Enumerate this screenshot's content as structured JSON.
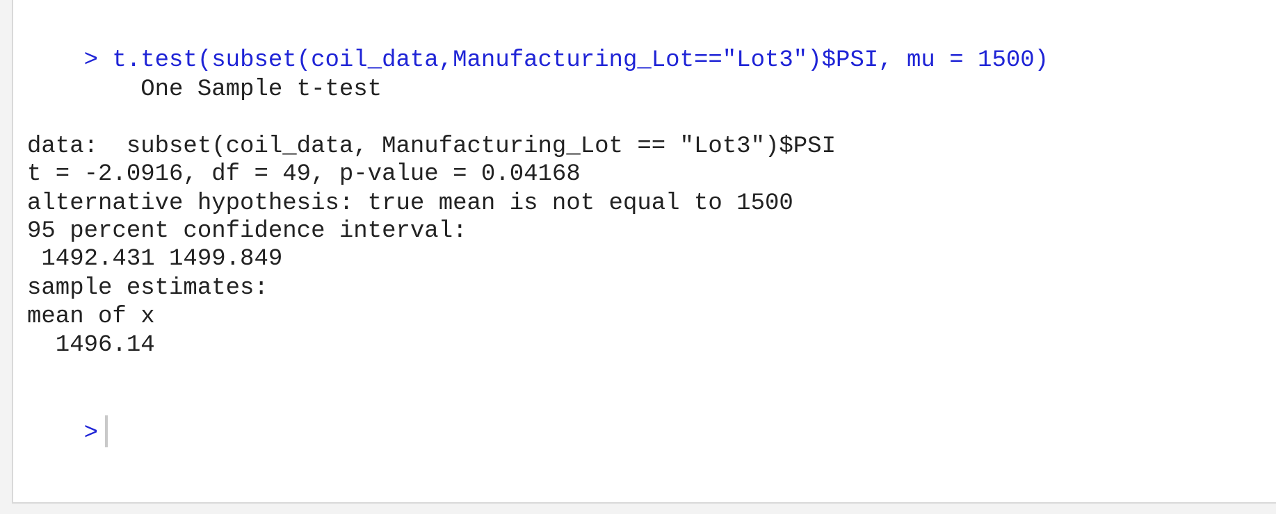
{
  "console": {
    "prompt_symbol": ">",
    "command": " t.test(subset(coil_data,Manufacturing_Lot==\"Lot3\")$PSI, mu = 1500)",
    "output": {
      "test_title": "        One Sample t-test",
      "data_line": "data:  subset(coil_data, Manufacturing_Lot == \"Lot3\")$PSI",
      "stats_line": "t = -2.0916, df = 49, p-value = 0.04168",
      "alt_hypothesis": "alternative hypothesis: true mean is not equal to 1500",
      "ci_label": "95 percent confidence interval:",
      "ci_values": " 1492.431 1499.849",
      "estimates_label": "sample estimates:",
      "estimate_name": "mean of x",
      "estimate_value": "  1496.14"
    },
    "next_prompt_symbol": ">"
  }
}
